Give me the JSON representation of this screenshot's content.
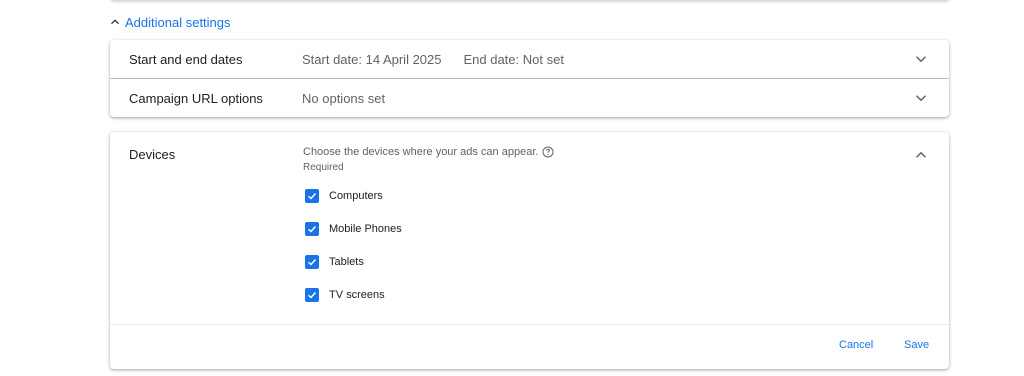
{
  "additional_settings": {
    "label": "Additional settings"
  },
  "dates": {
    "title": "Start and end dates",
    "start": "Start date: 14 April 2025",
    "end": "End date: Not set"
  },
  "url_options": {
    "title": "Campaign URL options",
    "summary": "No options set"
  },
  "devices": {
    "title": "Devices",
    "prompt": "Choose the devices where your ads can appear.",
    "required": "Required",
    "options": [
      {
        "label": "Computers",
        "checked": true
      },
      {
        "label": "Mobile Phones",
        "checked": true
      },
      {
        "label": "Tablets",
        "checked": true
      },
      {
        "label": "TV screens",
        "checked": true
      }
    ],
    "cancel_label": "Cancel",
    "save_label": "Save"
  },
  "colors": {
    "accent": "#1a73e8",
    "text": "#202124",
    "secondary": "#5f6368"
  }
}
